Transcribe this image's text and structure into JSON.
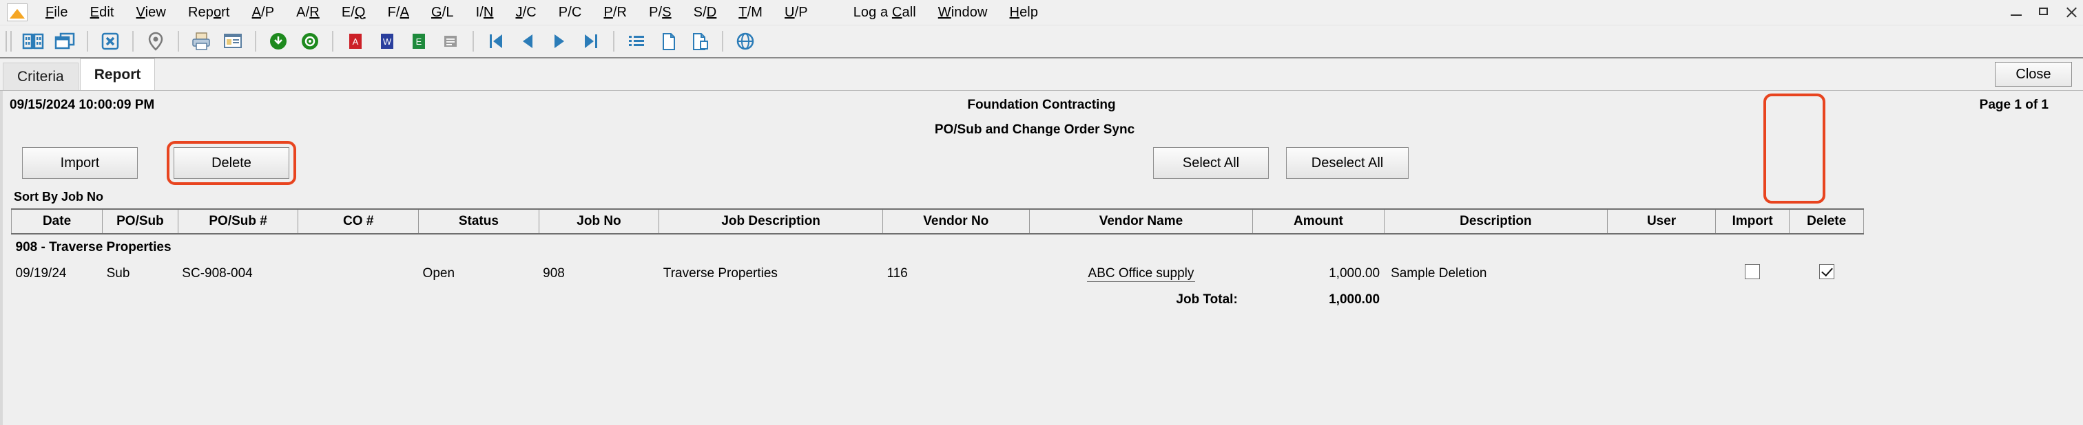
{
  "window": {
    "logo_name": "app-logo",
    "minimize": "minimize",
    "maximize": "maximize",
    "close": "close"
  },
  "menubar": {
    "items": [
      {
        "label": "File",
        "accel": "F"
      },
      {
        "label": "Edit",
        "accel": "E"
      },
      {
        "label": "View",
        "accel": "V"
      },
      {
        "label": "Report",
        "accel": "o"
      },
      {
        "label": "A/P",
        "accel": "A"
      },
      {
        "label": "A/R",
        "accel": "R"
      },
      {
        "label": "E/Q",
        "accel": "Q"
      },
      {
        "label": "F/A",
        "accel": "A"
      },
      {
        "label": "G/L",
        "accel": "G"
      },
      {
        "label": "I/N",
        "accel": "N"
      },
      {
        "label": "J/C",
        "accel": "J"
      },
      {
        "label": "P/C",
        "accel": "P"
      },
      {
        "label": "P/R",
        "accel": "P"
      },
      {
        "label": "P/S",
        "accel": "S"
      },
      {
        "label": "S/D",
        "accel": "D"
      },
      {
        "label": "T/M",
        "accel": "T"
      },
      {
        "label": "U/P",
        "accel": "U"
      },
      {
        "label": "Log a Call",
        "accel": "C"
      },
      {
        "label": "Window",
        "accel": "W"
      },
      {
        "label": "Help",
        "accel": "H"
      }
    ]
  },
  "toolbar": {
    "buttons": [
      {
        "icon": "book-icon",
        "group": 1
      },
      {
        "icon": "windows-cascade-icon",
        "group": 1
      },
      {
        "icon": "close-box-icon",
        "group": 2
      },
      {
        "icon": "map-pin-icon",
        "group": 3
      },
      {
        "icon": "print-icon",
        "group": 4
      },
      {
        "icon": "print-preview-icon",
        "group": 4
      },
      {
        "icon": "refresh-green-icon",
        "group": 5
      },
      {
        "icon": "globe-green-icon",
        "group": 5
      },
      {
        "icon": "export-pdf-icon",
        "group": 6
      },
      {
        "icon": "export-word-icon",
        "group": 6
      },
      {
        "icon": "export-excel-icon",
        "group": 6
      },
      {
        "icon": "export-text-icon",
        "group": 6
      },
      {
        "icon": "nav-first-icon",
        "group": 7
      },
      {
        "icon": "nav-prev-icon",
        "group": 7
      },
      {
        "icon": "nav-next-icon",
        "group": 7
      },
      {
        "icon": "nav-last-icon",
        "group": 7
      },
      {
        "icon": "list-icon",
        "group": 8
      },
      {
        "icon": "new-document-icon",
        "group": 8
      },
      {
        "icon": "copy-document-icon",
        "group": 8
      },
      {
        "icon": "globe-blue-icon",
        "group": 9
      }
    ]
  },
  "tabs": [
    {
      "label": "Criteria",
      "active": false
    },
    {
      "label": "Report",
      "active": true
    }
  ],
  "close_button": "Close",
  "report": {
    "timestamp": "09/15/2024 10:00:09 PM",
    "company": "Foundation Contracting",
    "page_info": "Page 1 of 1",
    "subtitle": "PO/Sub and Change Order Sync",
    "sort_by": "Sort By Job No",
    "buttons": {
      "import": "Import",
      "delete": "Delete",
      "select_all": "Select All",
      "deselect_all": "Deselect All"
    },
    "columns": [
      "Date",
      "PO/Sub",
      "PO/Sub #",
      "CO #",
      "Status",
      "Job No",
      "Job Description",
      "Vendor No",
      "Vendor Name",
      "Amount",
      "Description",
      "User",
      "Import",
      "Delete"
    ],
    "group_label": "908 - Traverse Properties",
    "rows": [
      {
        "date": "09/19/24",
        "po_sub": "Sub",
        "po_sub_no": "SC-908-004",
        "co_no": "",
        "status": "Open",
        "job_no": "908",
        "job_description": "Traverse Properties",
        "vendor_no": "116",
        "vendor_name": "ABC Office supply",
        "amount": "1,000.00",
        "description": "Sample Deletion",
        "user": "",
        "import_checked": false,
        "delete_checked": true
      }
    ],
    "total_label": "Job Total:",
    "total_value": "1,000.00"
  },
  "colors": {
    "highlight": "#e8441f",
    "toolbar_blue": "#2b7cb8",
    "green": "#1e8a1e",
    "window_bg": "#f0f0f0"
  }
}
